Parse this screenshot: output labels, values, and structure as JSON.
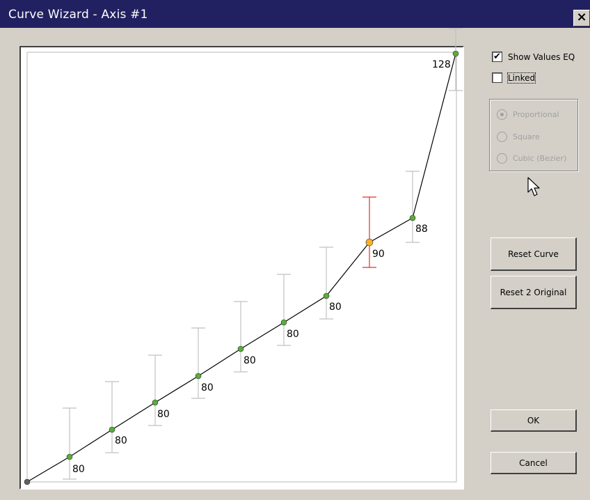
{
  "window": {
    "title": "Curve Wizard - Axis #1",
    "close_label": "✕"
  },
  "options": {
    "show_values_eq": {
      "label": "Show Values EQ",
      "checked": true
    },
    "linked": {
      "label": "Linked",
      "checked": false
    }
  },
  "curve_type": {
    "enabled": false,
    "options": [
      "Proportional",
      "Square",
      "Cubic (Bezier)"
    ],
    "selected": "Proportional"
  },
  "buttons": {
    "reset_curve": "Reset Curve",
    "reset_original": "Reset 2 Original",
    "ok": "OK",
    "cancel": "Cancel"
  },
  "curve": {
    "selected_index": 8,
    "colors": {
      "point": "#5aac3c",
      "selected_point": "#ffb020",
      "selected_bar": "#e03030",
      "bar": "#c0c0c0",
      "line": "#000000",
      "start_point": "#606060"
    },
    "point_labels": [
      "",
      "80",
      "80",
      "80",
      "80",
      "80",
      "80",
      "80",
      "90",
      "88",
      "128"
    ]
  },
  "icons": {
    "cursor": "mouse-pointer-icon",
    "check": "check-icon"
  }
}
